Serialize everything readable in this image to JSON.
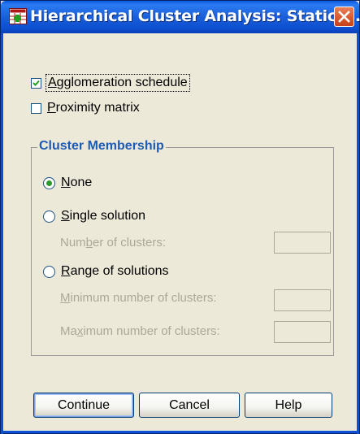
{
  "window": {
    "title": "Hierarchical Cluster Analysis: Statict...",
    "icon": "spss-dialog-icon",
    "close_icon": "close-icon",
    "colors": {
      "titlebar": "#0a5adf",
      "group_title": "#1c5bb8",
      "disabled_text": "#aca899"
    }
  },
  "options": {
    "agglomeration": {
      "label_mnemonic": "A",
      "label_rest": "gglomeration schedule",
      "checked": true
    },
    "proximity": {
      "label_mnemonic": "P",
      "label_rest": "roximity matrix",
      "checked": false
    }
  },
  "cluster_membership": {
    "title": "Cluster Membership",
    "none": {
      "label_mnemonic": "N",
      "label_rest": "one",
      "selected": true
    },
    "single": {
      "label_mnemonic": "S",
      "label_rest": "ingle solution",
      "selected": false,
      "num_clusters": {
        "pre": "Num",
        "mnemonic": "b",
        "post": "er of clusters:",
        "value": ""
      }
    },
    "range": {
      "label_mnemonic": "R",
      "label_rest": "ange of solutions",
      "selected": false,
      "min": {
        "pre": "",
        "mnemonic": "M",
        "post": "inimum number of clusters:",
        "value": ""
      },
      "max": {
        "pre": "Ma",
        "mnemonic": "x",
        "post": "imum number of clusters:",
        "value": ""
      }
    }
  },
  "buttons": {
    "continue": "Continue",
    "cancel": "Cancel",
    "help": "Help"
  }
}
